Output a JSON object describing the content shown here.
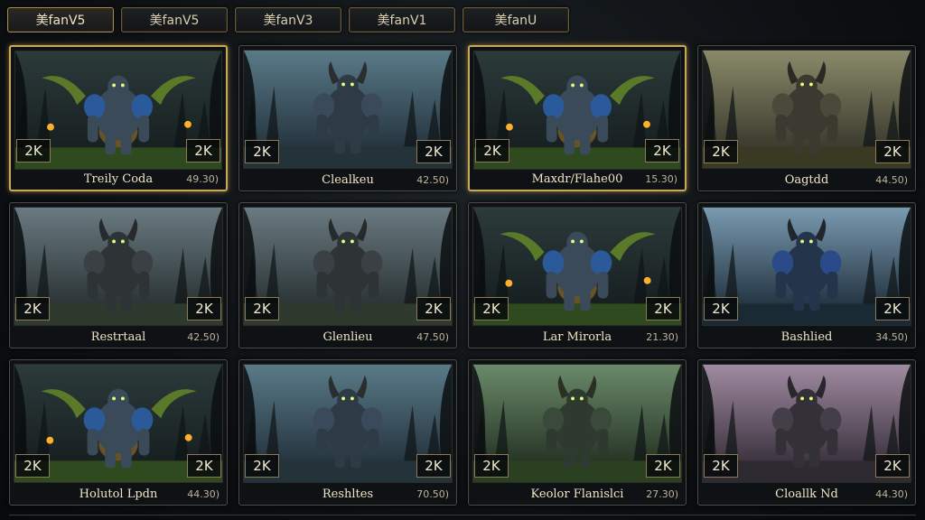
{
  "tabs": [
    {
      "label": "美fanV5",
      "active": true
    },
    {
      "label": "美fanV5",
      "active": false
    },
    {
      "label": "美fanV3",
      "active": false
    },
    {
      "label": "美fanV1",
      "active": false
    },
    {
      "label": "美fanU",
      "active": false
    }
  ],
  "cards": [
    {
      "name": "Treily Coda",
      "score": "49.30)",
      "badge_left": "2K",
      "badge_right": "2K",
      "scene": "fire",
      "selected": true
    },
    {
      "name": "Clealkeu",
      "score": "42.50)",
      "badge_left": "2K",
      "badge_right": "2K",
      "scene": "blue",
      "selected": false
    },
    {
      "name": "Maxdr/Flahe00",
      "score": "15.30)",
      "badge_left": "2K",
      "badge_right": "2K",
      "scene": "fire",
      "selected": true
    },
    {
      "name": "Oagtdd",
      "score": "44.50)",
      "badge_left": "2K",
      "badge_right": "2K",
      "scene": "olive",
      "selected": false
    },
    {
      "name": "Restrtaal",
      "score": "42.50)",
      "badge_left": "2K",
      "badge_right": "2K",
      "scene": "grey",
      "selected": false
    },
    {
      "name": "Glenlieu",
      "score": "47.50)",
      "badge_left": "2K",
      "badge_right": "2K",
      "scene": "grey",
      "selected": false
    },
    {
      "name": "Lar Mirorla",
      "score": "21.30)",
      "badge_left": "2K",
      "badge_right": "2K",
      "scene": "fire",
      "selected": false
    },
    {
      "name": "Bashlied",
      "score": "34.50)",
      "badge_left": "2K",
      "badge_right": "2K",
      "scene": "deepblue",
      "selected": false
    },
    {
      "name": "Holutol Lpdn",
      "score": "44.30)",
      "badge_left": "2K",
      "badge_right": "2K",
      "scene": "fire",
      "selected": false
    },
    {
      "name": "Reshltes",
      "score": "70.50)",
      "badge_left": "2K",
      "badge_right": "2K",
      "scene": "blue",
      "selected": false
    },
    {
      "name": "Keolor Flanislci",
      "score": "27.30)",
      "badge_left": "2K",
      "badge_right": "2K",
      "scene": "green",
      "selected": false
    },
    {
      "name": "Cloallk Nd",
      "score": "44.30)",
      "badge_left": "2K",
      "badge_right": "2K",
      "scene": "pink",
      "selected": false
    }
  ]
}
